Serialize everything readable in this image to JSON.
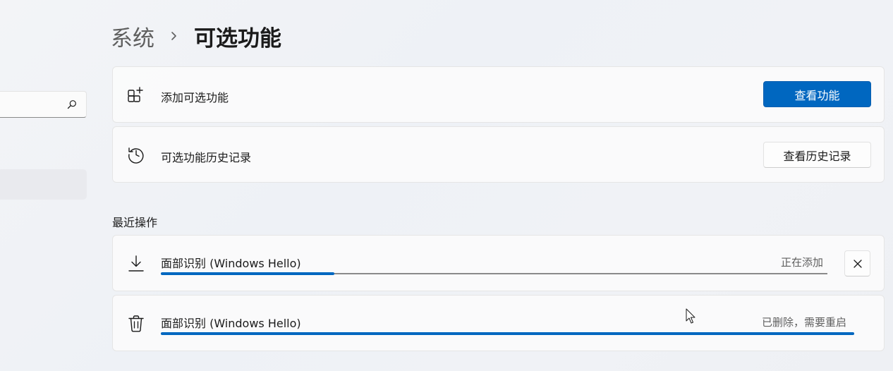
{
  "left_pane": {
    "search": {
      "placeholder": "",
      "icon": "search-icon"
    }
  },
  "breadcrumb": {
    "parent": "系统",
    "separator_icon": "chevron-right-icon",
    "current": "可选功能"
  },
  "add_feature": {
    "icon": "add-apps-icon",
    "label": "添加可选功能",
    "button_label": "查看功能"
  },
  "history": {
    "icon": "history-icon",
    "label": "可选功能历史记录",
    "button_label": "查看历史记录"
  },
  "recent": {
    "heading": "最近操作",
    "items": [
      {
        "icon": "download-icon",
        "name": "面部识别 (Windows Hello)",
        "status": "正在添加",
        "progress": 0.26,
        "action_icon": "close-icon"
      },
      {
        "icon": "trash-icon",
        "name": "面部识别 (Windows Hello)",
        "status": "已删除，需要重启",
        "progress": 1.0
      }
    ]
  },
  "colors": {
    "accent": "#0067c0",
    "track": "#8a8a8a",
    "card_bg": "#fbfbfb"
  }
}
